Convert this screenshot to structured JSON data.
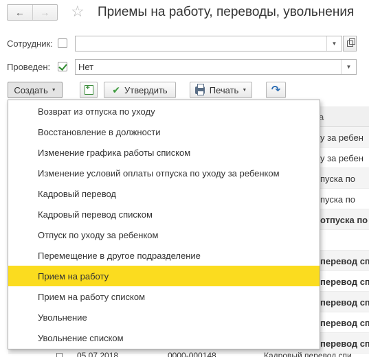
{
  "header": {
    "back_glyph": "←",
    "forward_glyph": "→",
    "favorite_glyph": "☆",
    "title": "Приемы на работу, переводы, увольнения"
  },
  "filters": {
    "employee_label": "Сотрудник:",
    "employee_checked": false,
    "employee_value": "",
    "posted_label": "Проведен:",
    "posted_checked": true,
    "posted_value": "Нет"
  },
  "toolbar": {
    "create_label": "Создать",
    "approve_label": "Утвердить",
    "print_label": "Печать"
  },
  "table": {
    "type_header": "а",
    "rows": [
      {
        "text": "у за ребен",
        "bold": false
      },
      {
        "text": "у за ребен",
        "bold": false
      },
      {
        "text": "пуска по",
        "bold": false
      },
      {
        "text": "пуска по",
        "bold": false
      },
      {
        "text": "отпуска по",
        "bold": true
      },
      {
        "text": "",
        "bold": false
      },
      {
        "text": "перевод спи",
        "bold": true
      },
      {
        "text": "перевод спи",
        "bold": true
      },
      {
        "text": "перевод спи",
        "bold": true
      },
      {
        "text": "перевод спи",
        "bold": true
      },
      {
        "text": "перевод спи",
        "bold": true
      }
    ],
    "bottom_row": {
      "date": "05.07.2018",
      "number": "0000-000148",
      "type": "Кадровый перевод спи"
    }
  },
  "create_menu": {
    "selected_index": 8,
    "items": [
      "Возврат из отпуска по уходу",
      "Восстановление в должности",
      "Изменение графика работы списком",
      "Изменение условий оплаты отпуска по уходу за ребенком",
      "Кадровый перевод",
      "Кадровый перевод списком",
      "Отпуск по уходу за ребенком",
      "Перемещение в другое подразделение",
      "Прием на работу",
      "Прием на работу списком",
      "Увольнение",
      "Увольнение списком"
    ]
  },
  "colors": {
    "selected_item": "#fbdc1f",
    "check_green": "#2e8b2e",
    "post_blue": "#2f6fb4"
  }
}
